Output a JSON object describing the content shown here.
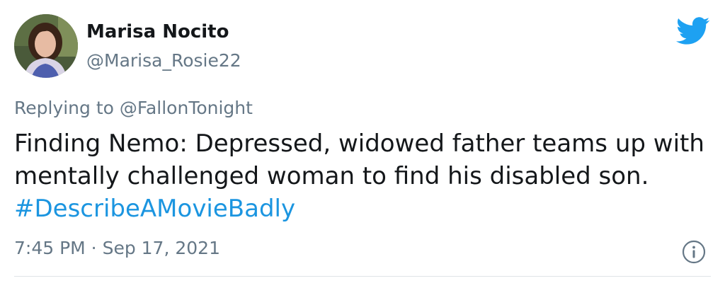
{
  "author": {
    "display_name": "Marisa Nocito",
    "handle": "@Marisa_Rosie22",
    "avatar_icon": "profile-photo"
  },
  "reply": {
    "prefix": "Replying to ",
    "target": "@FallonTonight"
  },
  "tweet": {
    "text": "Finding Nemo: Depressed, widowed father teams up with mentally challenged woman to find his disabled son. ",
    "hashtag": "#DescribeAMovieBadly"
  },
  "meta": {
    "time": "7:45 PM",
    "separator": " · ",
    "date": "Sep 17, 2021"
  },
  "icons": {
    "brand": "twitter-bird-icon",
    "info": "info-icon"
  },
  "colors": {
    "brand_blue": "#1da1f2",
    "hashtag_blue": "#1b95e0",
    "secondary_text": "#657786",
    "primary_text": "#14171a"
  }
}
